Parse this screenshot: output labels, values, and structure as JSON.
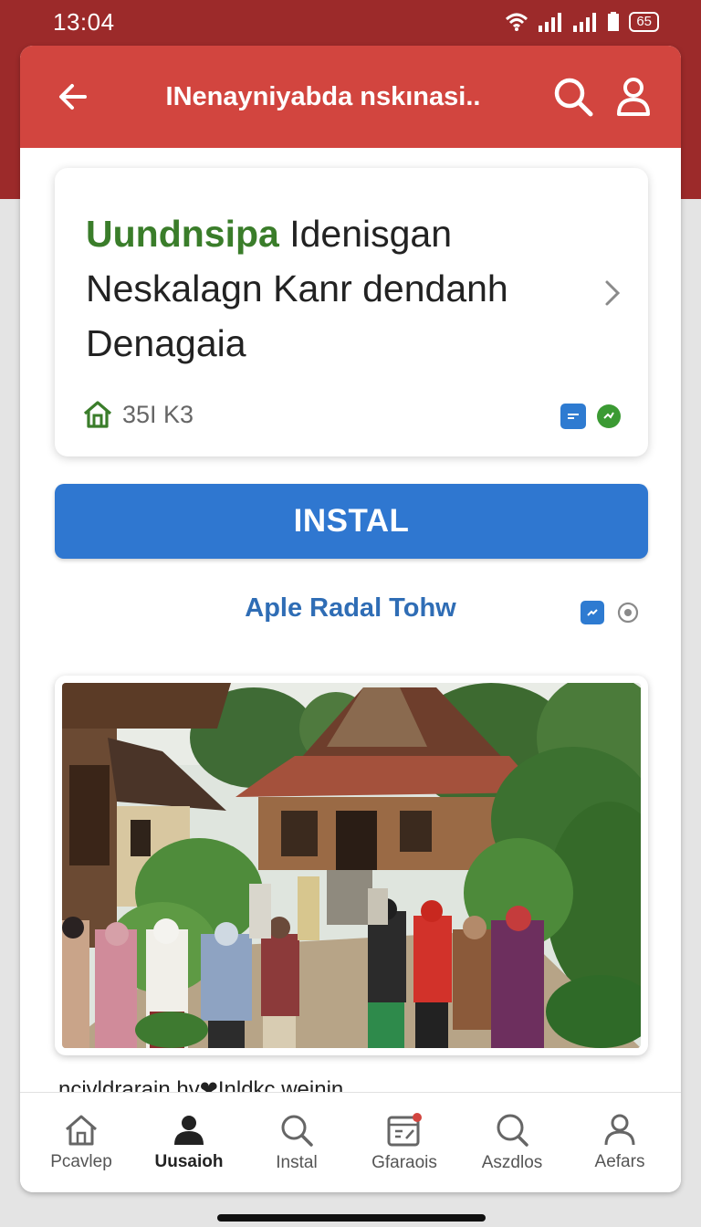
{
  "status_bar": {
    "time": "13:04",
    "battery_text": "65"
  },
  "app_bar": {
    "title": "INenayniyabda nskınasi.."
  },
  "app_card": {
    "name_accent": "Uundnsipa",
    "name_rest": " Idenisgan Neskalagn Kanr dendanh Denagaia",
    "meta": "35I K3"
  },
  "install_button": {
    "label": "INSTAL"
  },
  "sub_link": "Aple Radal Tohw",
  "description_cut": "ncivldrarain hv❤Inldkc weinin",
  "bottom_nav": [
    {
      "label": "Pcavlep",
      "icon": "home-icon"
    },
    {
      "label": "Uusaioh",
      "icon": "person-icon"
    },
    {
      "label": "Instal",
      "icon": "search-icon"
    },
    {
      "label": "Gfaraois",
      "icon": "calendar-icon"
    },
    {
      "label": "Aszdlos",
      "icon": "search-icon"
    },
    {
      "label": "Aefars",
      "icon": "user-icon"
    }
  ],
  "colors": {
    "app_bar": "#d2453f",
    "status_band": "#9c2a2a",
    "accent_green": "#3a7d2a",
    "primary_blue": "#2f77d0"
  }
}
